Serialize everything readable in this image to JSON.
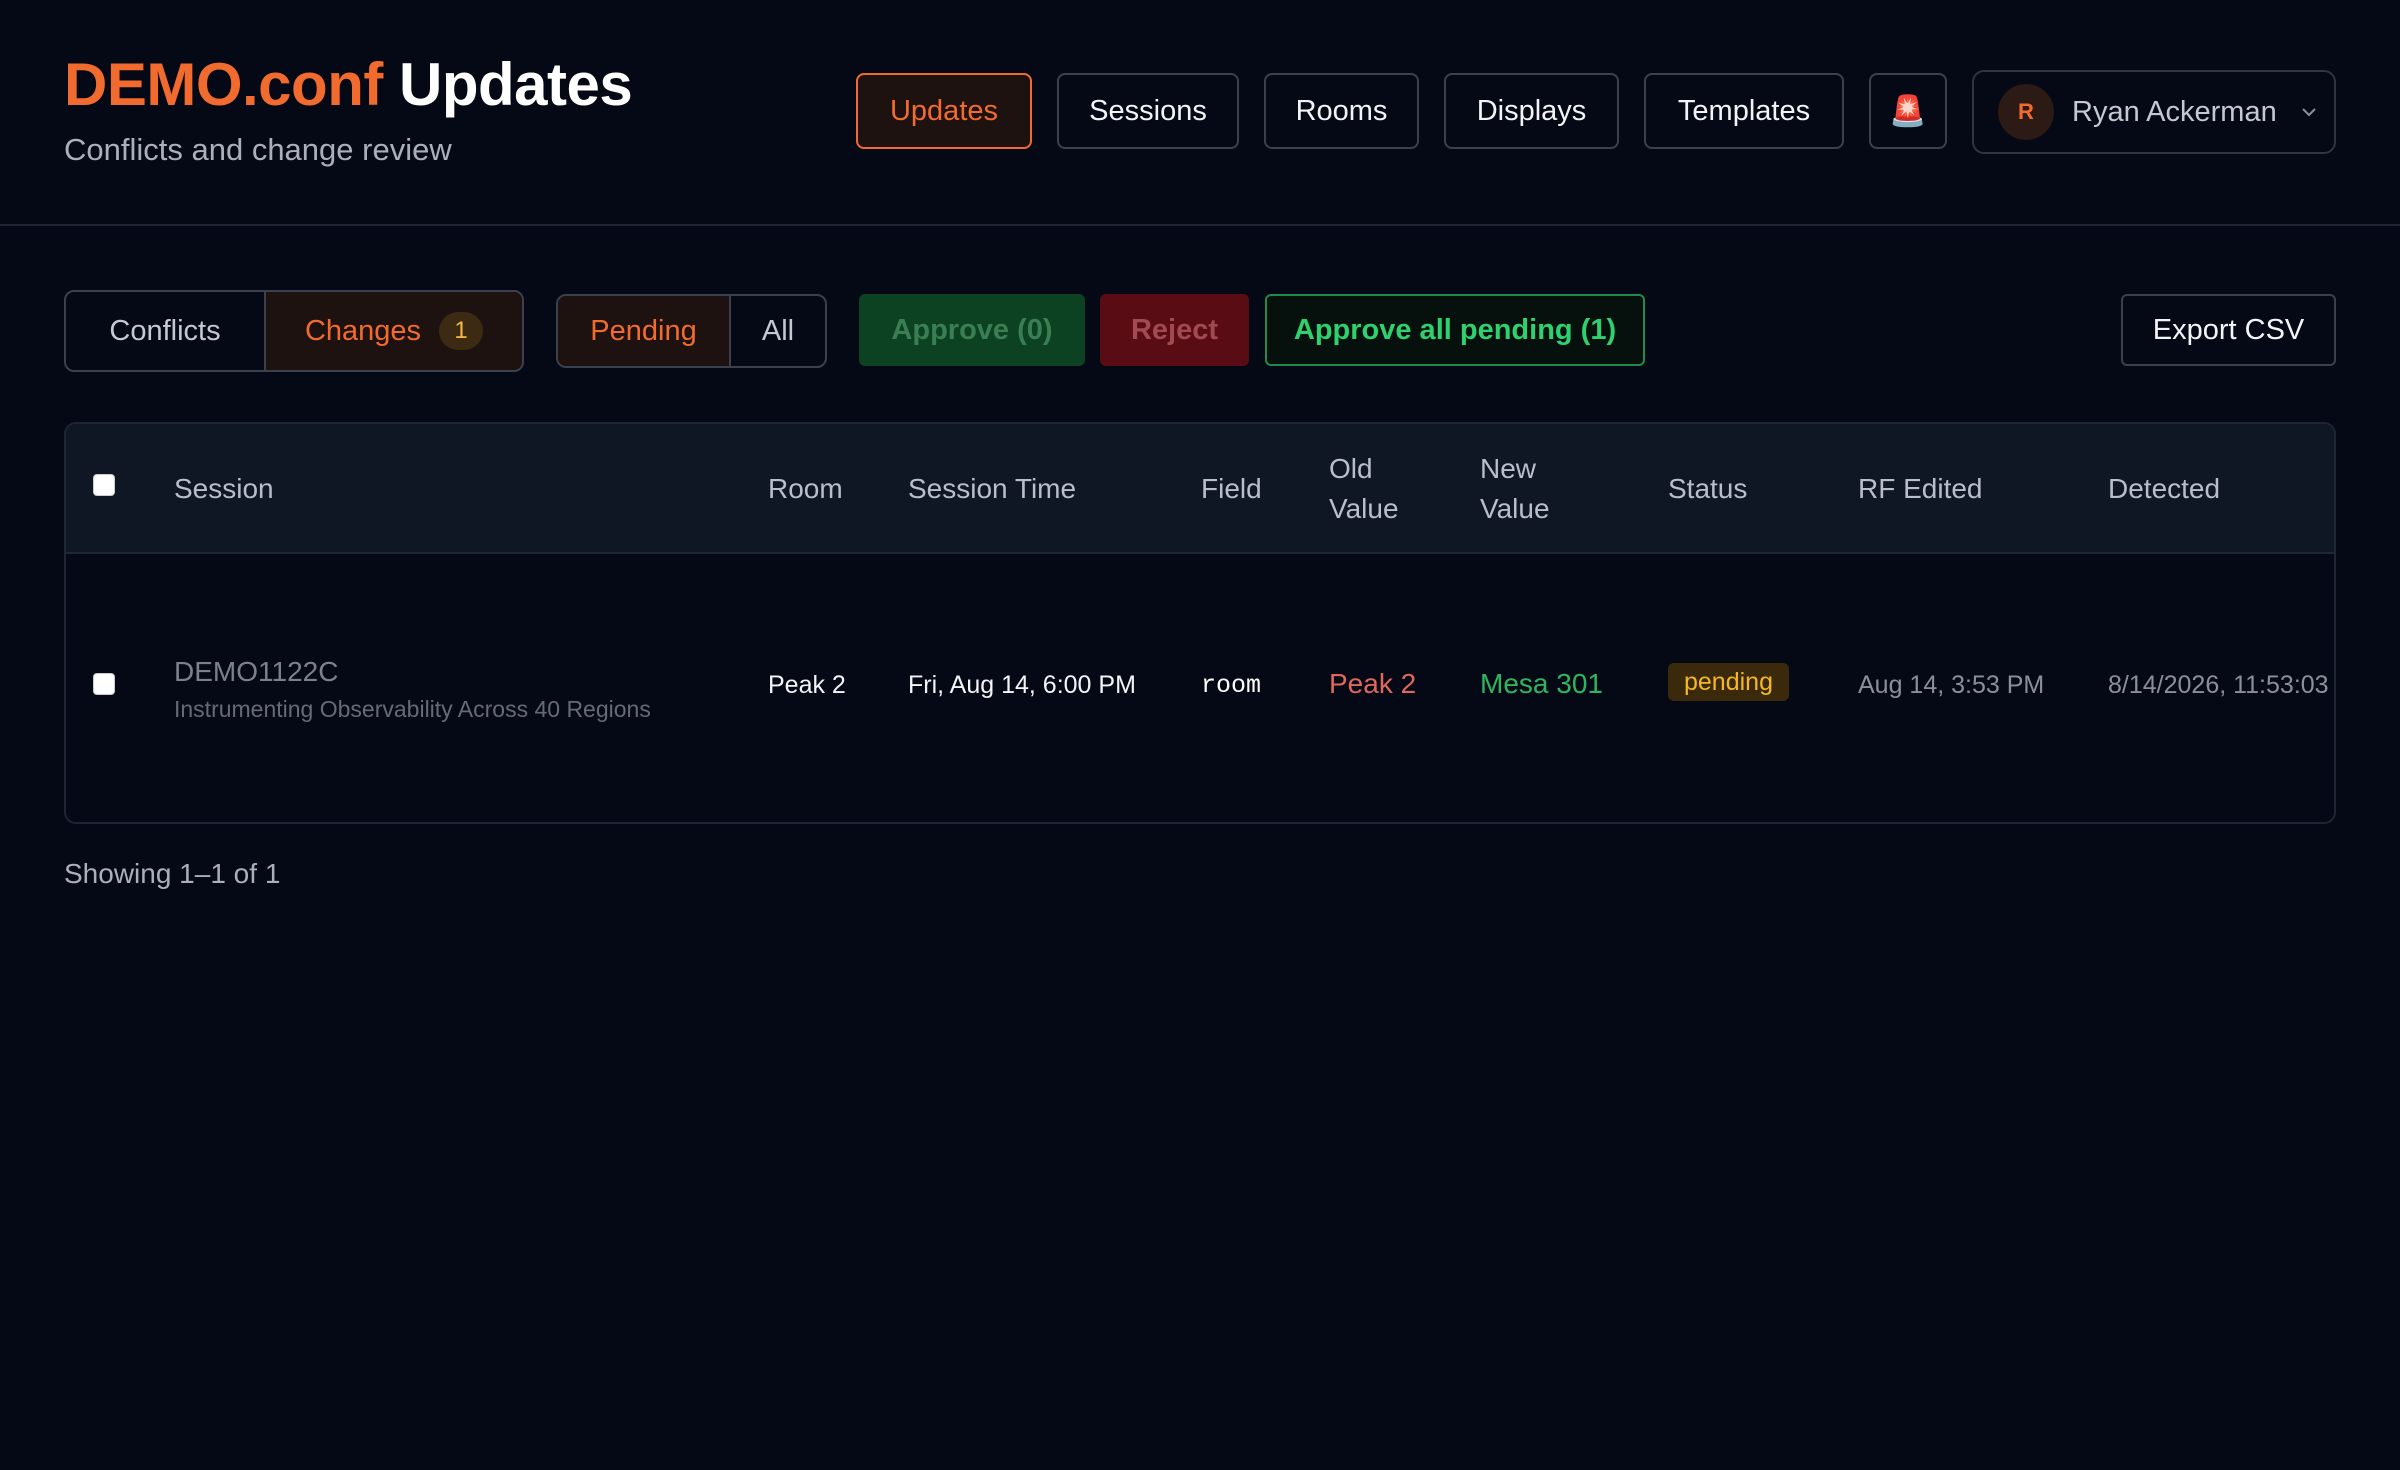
{
  "brand": {
    "accent_text": "DEMO.conf",
    "title_text": "Updates",
    "subtitle": "Conflicts and change review",
    "accent_color": "#f26b2e"
  },
  "nav": {
    "items": [
      {
        "label": "Updates",
        "active": true
      },
      {
        "label": "Sessions",
        "active": false
      },
      {
        "label": "Rooms",
        "active": false
      },
      {
        "label": "Displays",
        "active": false
      },
      {
        "label": "Templates",
        "active": false
      }
    ],
    "alert_icon": "alarm-light-icon",
    "alert_glyph": "🚨"
  },
  "user": {
    "initial": "R",
    "name": "Ryan Ackerman"
  },
  "tabs": {
    "conflicts_label": "Conflicts",
    "changes_label": "Changes",
    "changes_count": "1",
    "active": "Changes"
  },
  "filters": {
    "pending_label": "Pending",
    "all_label": "All",
    "active": "Pending"
  },
  "actions": {
    "approve_label": "Approve (0)",
    "reject_label": "Reject",
    "approve_all_label": "Approve all pending (1)",
    "export_label": "Export CSV"
  },
  "table": {
    "columns": {
      "session": "Session",
      "room": "Room",
      "session_time": "Session Time",
      "field": "Field",
      "old_value_line1": "Old",
      "old_value_line2": "Value",
      "new_value_line1": "New",
      "new_value_line2": "Value",
      "status": "Status",
      "rf_edited": "RF Edited",
      "detected": "Detected"
    },
    "rows": [
      {
        "session_code": "DEMO1122C",
        "session_title": "Instrumenting Observability Across 40 Regions",
        "room": "Peak 2",
        "session_time": "Fri, Aug 14, 6:00 PM",
        "field": "room",
        "old_value": "Peak 2",
        "new_value": "Mesa 301",
        "status": "pending",
        "rf_edited": "Aug 14, 3:53 PM",
        "detected": "8/14/2026, 11:53:03"
      }
    ]
  },
  "footer": {
    "showing": "Showing 1–1 of 1"
  }
}
